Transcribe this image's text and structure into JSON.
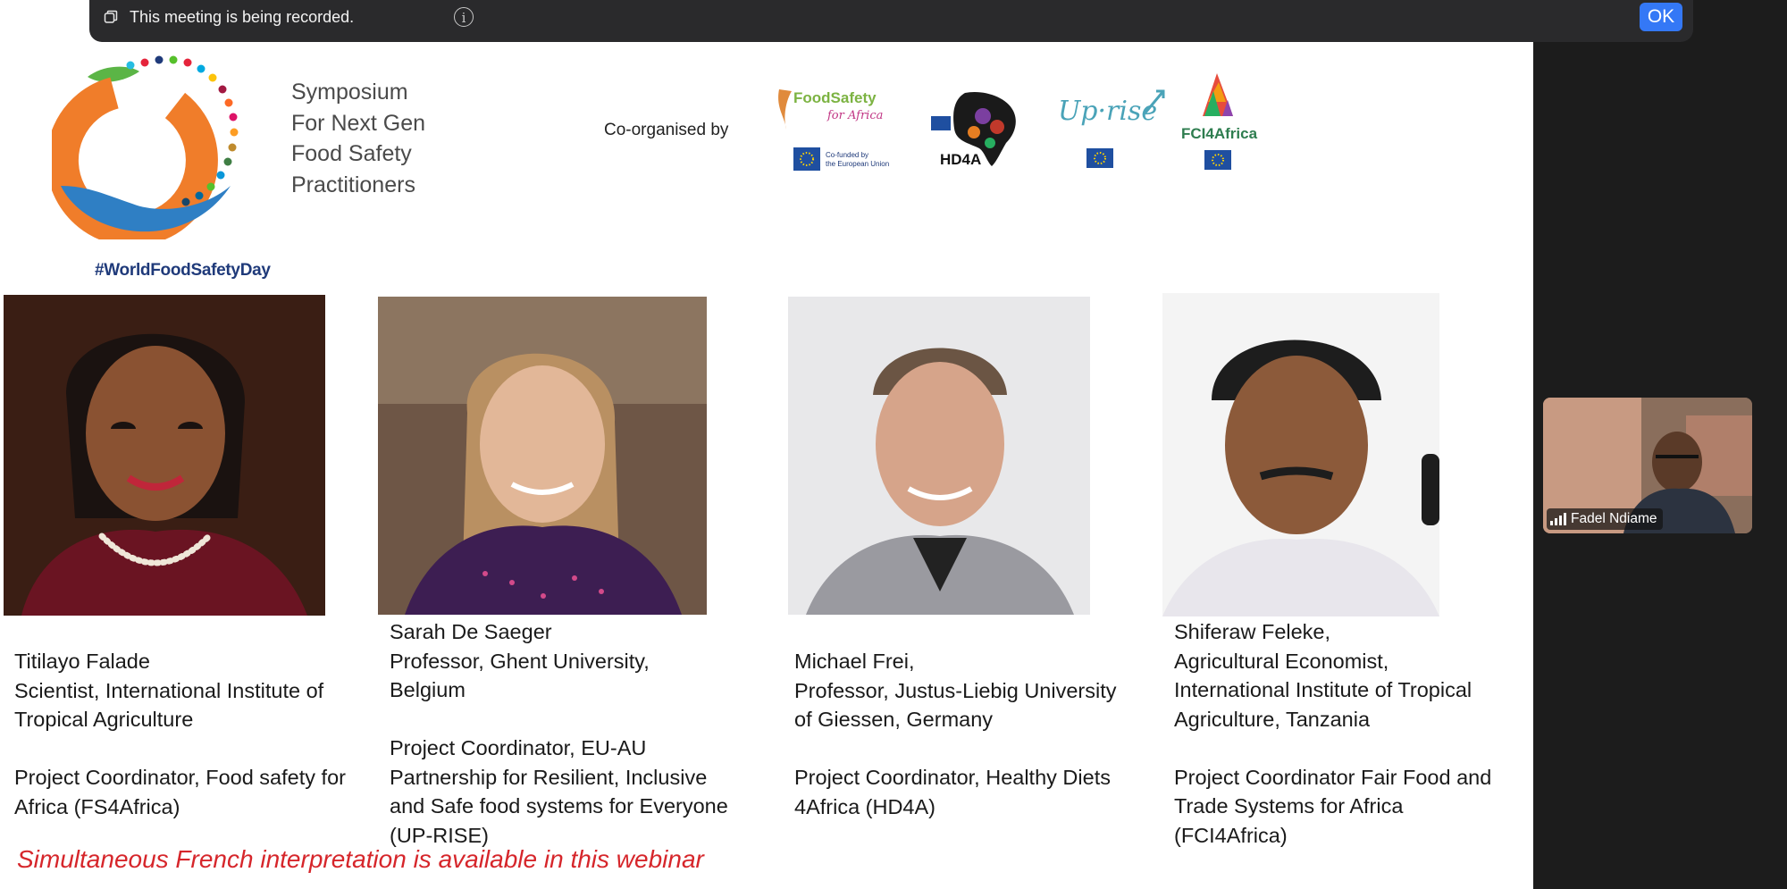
{
  "recording_banner": {
    "message": "This meeting is being recorded.",
    "info_glyph": "i",
    "ok_label": "OK"
  },
  "symposium": {
    "lines": [
      "Symposium",
      "For Next Gen",
      "Food Safety",
      "Practitioners"
    ],
    "hashtag": "#WorldFoodSafetyDay"
  },
  "coorganised_label": "Co-organised by",
  "partners": {
    "fs4africa": {
      "name_line1": "FoodSafety",
      "name_line2": "for Africa",
      "cofunded_line1": "Co-funded by",
      "cofunded_line2": "the European Union"
    },
    "hd4a": {
      "name": "HD4A"
    },
    "uprise": {
      "name": "Up·rise"
    },
    "fci4africa": {
      "name": "FCI4Africa"
    }
  },
  "speakers": [
    {
      "lines": [
        "Titilayo Falade",
        "Scientist, International Institute of",
        "Tropical Agriculture",
        "",
        "Project Coordinator, Food safety for",
        "Africa (FS4Africa)"
      ]
    },
    {
      "lines": [
        "Sarah De Saeger",
        "Professor, Ghent University,",
        "Belgium",
        "",
        "Project Coordinator, EU-AU",
        "Partnership for Resilient, Inclusive",
        "and Safe food systems for Everyone",
        "(UP-RISE)"
      ]
    },
    {
      "lines": [
        "Michael Frei,",
        "Professor, Justus-Liebig University",
        "of Giessen, Germany",
        "",
        "Project Coordinator, Healthy Diets",
        "4Africa (HD4A)"
      ]
    },
    {
      "lines": [
        "Shiferaw Feleke,",
        "Agricultural Economist,",
        "International Institute of Tropical",
        "Agriculture, Tanzania",
        "",
        "Project Coordinator Fair Food and",
        "Trade Systems for Africa",
        "(FCI4Africa)"
      ]
    }
  ],
  "interpretation_note": "Simultaneous French interpretation is available in this webinar",
  "participant": {
    "name": "Fadel Ndiame"
  },
  "colors": {
    "ok_button": "#3478f6",
    "interpretation_text": "#d6262b",
    "banner_bg": "#2a2a2c"
  }
}
